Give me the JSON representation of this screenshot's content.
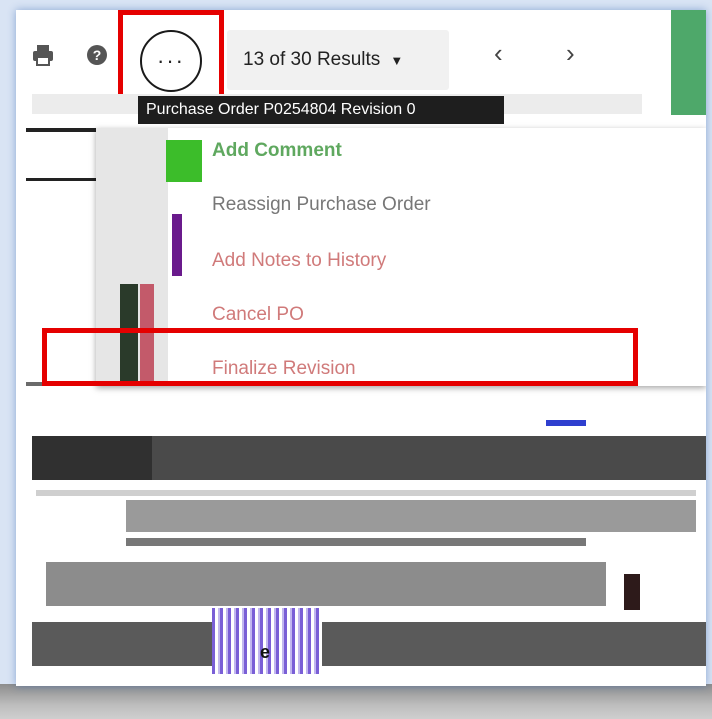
{
  "toolbar": {
    "more_label": "···",
    "results_label": "13 of 30 Results",
    "results_caret": "▼",
    "prev_label": "‹",
    "next_label": "›"
  },
  "tooltip": {
    "text": "Purchase Order P0254804 Revision 0"
  },
  "menu": {
    "items": [
      {
        "label": "Add Comment"
      },
      {
        "label": "Reassign Purchase Order"
      },
      {
        "label": "Add Notes to History"
      },
      {
        "label": "Cancel PO"
      },
      {
        "label": "Finalize Revision"
      }
    ]
  },
  "colors": {
    "highlight": "#e50000",
    "green_accent": "#4ea86a",
    "menu_text": "#d07a7a"
  },
  "icons": [
    "print-icon",
    "help-icon",
    "more-icon",
    "chevron-left-icon",
    "chevron-right-icon",
    "dropdown-caret-icon"
  ]
}
